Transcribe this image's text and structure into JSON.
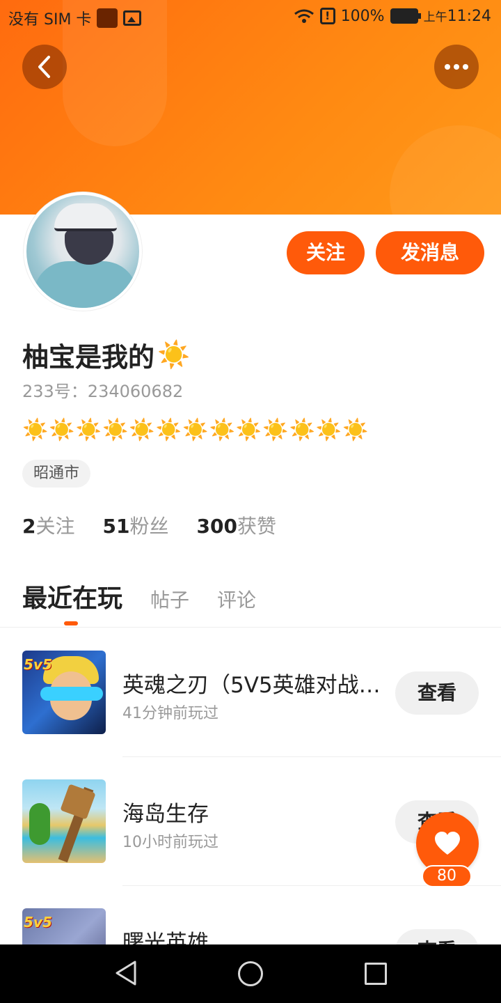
{
  "statusbar": {
    "carrier": "没有 SIM 卡",
    "battery": "100%",
    "ampm": "上午",
    "time": "11:24"
  },
  "header": {
    "back_icon": "chevron-left-icon",
    "more_icon": "more-dots-icon"
  },
  "profile": {
    "name": "柚宝是我的",
    "name_emoji": "☀️",
    "id_text": "233号：234060682",
    "suns": "☀️☀️☀️☀️☀️☀️☀️☀️☀️☀️☀️☀️☀️",
    "city": "昭通市",
    "follow_label": "关注",
    "message_label": "发消息"
  },
  "stats": [
    {
      "num": "2",
      "label": "关注"
    },
    {
      "num": "51",
      "label": "粉丝"
    },
    {
      "num": "300",
      "label": "获赞"
    }
  ],
  "tabs": [
    {
      "label": "最近在玩",
      "active": true
    },
    {
      "label": "帖子"
    },
    {
      "label": "评论"
    }
  ],
  "games": [
    {
      "title": "英魂之刃（5V5英雄对战…",
      "sub": "41分钟前玩过",
      "button": "查看",
      "badge": "5v5"
    },
    {
      "title": "海岛生存",
      "sub": "10小时前玩过",
      "button": "查看"
    },
    {
      "title": "曙光英雄",
      "sub": "",
      "button": "查看",
      "badge": "5v5"
    }
  ],
  "fab": {
    "icon": "heart-icon",
    "count": "80"
  },
  "nav": {
    "back": "nav-back-icon",
    "home": "nav-home-icon",
    "recent": "nav-recent-icon"
  },
  "colors": {
    "accent": "#ff5a0a",
    "header_gradient_start": "#ff6b0f",
    "header_gradient_end": "#ff9a1a"
  }
}
